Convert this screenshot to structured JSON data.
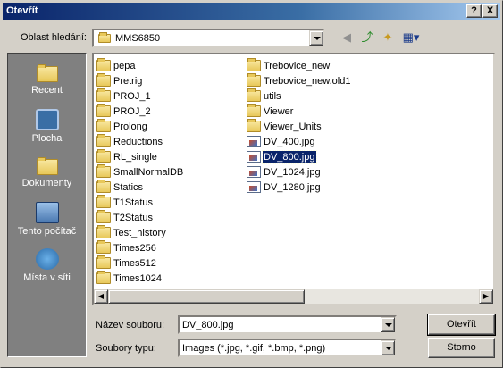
{
  "window": {
    "title": "Otevřít",
    "help": "?",
    "close": "X"
  },
  "toolbar": {
    "look_in_label": "Oblast hledání:",
    "look_in_value": "MMS6850",
    "back_icon": "back-arrow-icon",
    "up_icon": "up-folder-icon",
    "new_folder_icon": "new-folder-icon",
    "views_icon": "views-menu-icon"
  },
  "places": [
    {
      "label": "Recent",
      "icon": "recent-folder-icon"
    },
    {
      "label": "Plocha",
      "icon": "desktop-icon"
    },
    {
      "label": "Dokumenty",
      "icon": "documents-icon"
    },
    {
      "label": "Tento počítač",
      "icon": "computer-icon"
    },
    {
      "label": "Místa v síti",
      "icon": "network-icon"
    }
  ],
  "files_col1": [
    {
      "name": "pepa",
      "type": "folder"
    },
    {
      "name": "Pretrig",
      "type": "folder"
    },
    {
      "name": "PROJ_1",
      "type": "folder"
    },
    {
      "name": "PROJ_2",
      "type": "folder"
    },
    {
      "name": "Prolong",
      "type": "folder"
    },
    {
      "name": "Reductions",
      "type": "folder"
    },
    {
      "name": "RL_single",
      "type": "folder"
    },
    {
      "name": "SmallNormalDB",
      "type": "folder"
    },
    {
      "name": "Statics",
      "type": "folder"
    },
    {
      "name": "T1Status",
      "type": "folder"
    },
    {
      "name": "T2Status",
      "type": "folder"
    },
    {
      "name": "Test_history",
      "type": "folder"
    },
    {
      "name": "Times256",
      "type": "folder"
    },
    {
      "name": "Times512",
      "type": "folder"
    },
    {
      "name": "Times1024",
      "type": "folder"
    }
  ],
  "files_col2": [
    {
      "name": "Trebovice_new",
      "type": "folder"
    },
    {
      "name": "Trebovice_new.old1",
      "type": "folder"
    },
    {
      "name": "utils",
      "type": "folder"
    },
    {
      "name": "Viewer",
      "type": "folder"
    },
    {
      "name": "Viewer_Units",
      "type": "folder"
    },
    {
      "name": "DV_400.jpg",
      "type": "jpg"
    },
    {
      "name": "DV_800.jpg",
      "type": "jpg",
      "selected": true
    },
    {
      "name": "DV_1024.jpg",
      "type": "jpg"
    },
    {
      "name": "DV_1280.jpg",
      "type": "jpg"
    }
  ],
  "filename": {
    "label": "Název souboru:",
    "value": "DV_800.jpg"
  },
  "filetype": {
    "label": "Soubory typu:",
    "value": "Images (*.jpg, *.gif, *.bmp, *.png)"
  },
  "buttons": {
    "open": "Otevřít",
    "cancel": "Storno"
  }
}
